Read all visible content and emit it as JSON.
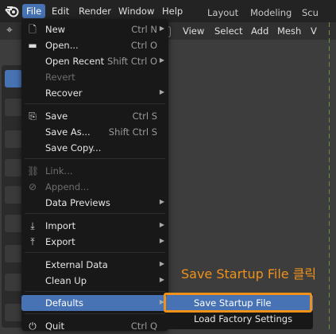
{
  "topbar": {
    "menus": [
      "File",
      "Edit",
      "Render",
      "Window",
      "Help"
    ],
    "workspaces": [
      "Layout",
      "Modeling",
      "Scu"
    ]
  },
  "viewport": {
    "menus": [
      "View",
      "Select",
      "Add",
      "Mesh",
      "V"
    ]
  },
  "file_menu": {
    "items": [
      {
        "icon": "new-file-icon",
        "label": "New",
        "shortcut": "Ctrl N",
        "arrow": true
      },
      {
        "icon": "folder-icon",
        "label": "Open...",
        "shortcut": "Ctrl O",
        "arrow": false
      },
      {
        "icon": "",
        "label": "Open Recent",
        "shortcut": "Shift Ctrl O",
        "arrow": true
      },
      {
        "icon": "",
        "label": "Revert",
        "shortcut": "",
        "arrow": false,
        "disabled": true
      },
      {
        "icon": "",
        "label": "Recover",
        "shortcut": "",
        "arrow": true
      },
      {
        "icon": "save-icon",
        "label": "Save",
        "shortcut": "Ctrl S",
        "arrow": false
      },
      {
        "icon": "",
        "label": "Save As...",
        "shortcut": "Shift Ctrl S",
        "arrow": false
      },
      {
        "icon": "",
        "label": "Save Copy...",
        "shortcut": "",
        "arrow": false
      },
      {
        "icon": "link-icon",
        "label": "Link...",
        "shortcut": "",
        "arrow": false,
        "disabled": true
      },
      {
        "icon": "append-icon",
        "label": "Append...",
        "shortcut": "",
        "arrow": false,
        "disabled": true
      },
      {
        "icon": "",
        "label": "Data Previews",
        "shortcut": "",
        "arrow": true
      },
      {
        "icon": "import-icon",
        "label": "Import",
        "shortcut": "",
        "arrow": true
      },
      {
        "icon": "export-icon",
        "label": "Export",
        "shortcut": "",
        "arrow": true
      },
      {
        "icon": "",
        "label": "External Data",
        "shortcut": "",
        "arrow": true
      },
      {
        "icon": "",
        "label": "Clean Up",
        "shortcut": "",
        "arrow": true
      },
      {
        "icon": "",
        "label": "Defaults",
        "shortcut": "",
        "arrow": true,
        "highlight": true
      },
      {
        "icon": "quit-icon",
        "label": "Quit",
        "shortcut": "Ctrl Q",
        "arrow": false
      }
    ]
  },
  "defaults_submenu": {
    "items": [
      "Save Startup File",
      "Load Factory Settings"
    ]
  },
  "annotation": "Save Startup File 클릭",
  "colors": {
    "accent": "#4772b3",
    "annotation": "#f0921a",
    "menu_bg": "#181818"
  }
}
